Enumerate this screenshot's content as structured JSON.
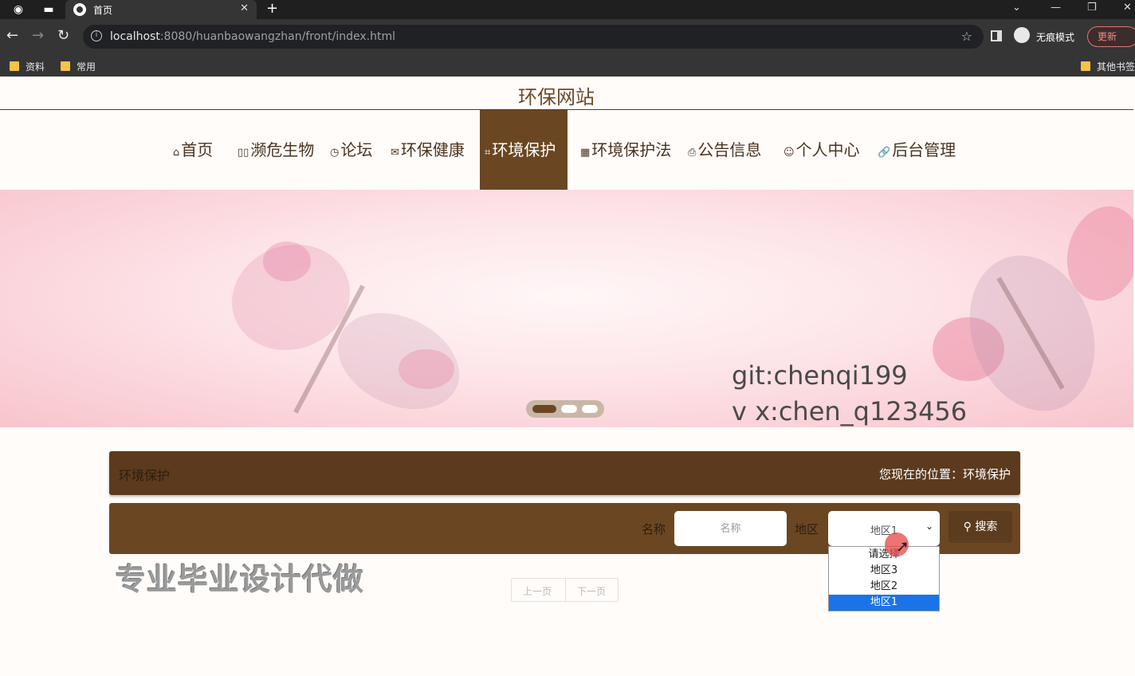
{
  "browser": {
    "tab_title": "首页",
    "url_host": "localhost",
    "url_rest": ":8080/huanbaowangzhan/front/index.html",
    "incognito_label": "无痕模式",
    "update_label": "更新",
    "bookmarks": [
      "资料",
      "常用"
    ],
    "other_bookmarks": "其他书签"
  },
  "site": {
    "title": "环保网站"
  },
  "nav": {
    "items": [
      {
        "icon": "⌂",
        "label": "首页"
      },
      {
        "icon": "▯▯",
        "label": "濒危生物"
      },
      {
        "icon": "◷",
        "label": "论坛"
      },
      {
        "icon": "✉",
        "label": "环保健康"
      },
      {
        "icon": "⌗",
        "label": "环境保护"
      },
      {
        "icon": "▦",
        "label": "环境保护法"
      },
      {
        "icon": "⎙",
        "label": "公告信息"
      },
      {
        "icon": "☺",
        "label": "个人中心"
      },
      {
        "icon": "🔗",
        "label": "后台管理"
      }
    ],
    "active_index": 4
  },
  "banner": {
    "line1": "git:chenqi199",
    "line2": "v x:chen_q123456",
    "slides": 3,
    "active_slide": 0
  },
  "section": {
    "title": "环境保护",
    "breadcrumb": "您现在的位置：环境保护"
  },
  "search": {
    "name_label": "名称",
    "name_placeholder": "名称",
    "region_label": "地区",
    "region_value": "地区1",
    "button_label": "搜索",
    "options": [
      "请选择",
      "地区3",
      "地区2",
      "地区1"
    ],
    "selected_option": "地区1"
  },
  "overlay": {
    "watermark": "专业毕业设计代做"
  },
  "pagination": {
    "prev": "上一页",
    "next": "下一页"
  }
}
